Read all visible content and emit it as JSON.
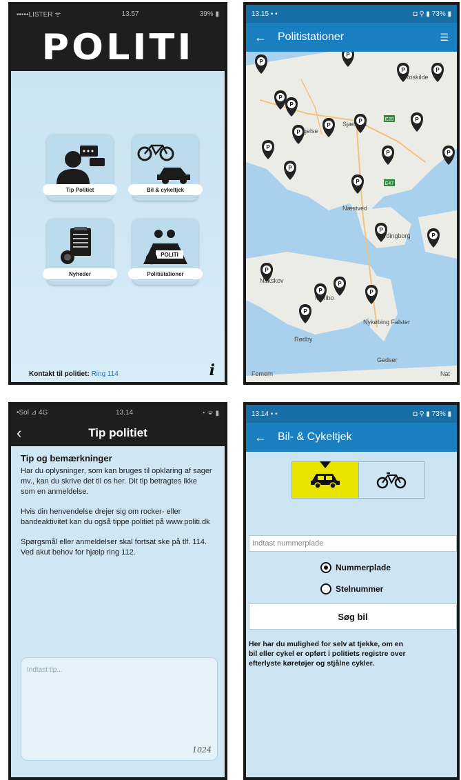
{
  "home": {
    "status": {
      "carrier": "•••••LISTER ᯤ",
      "time": "13.57",
      "battery": "39% ▮"
    },
    "logo": "POLITI",
    "tiles": [
      {
        "label": "Tip Politiet"
      },
      {
        "label": "Bil & cykeltjek"
      },
      {
        "label": "Nyheder"
      },
      {
        "label": "Politistationer"
      }
    ],
    "badge_text": "POLITI",
    "contact_label": "Kontakt til politiet:",
    "contact_link": "Ring 114"
  },
  "stations": {
    "status": {
      "left": "13.15 ▪ ▪",
      "right": "◘ ⚲ ▮ 73% ▮"
    },
    "title": "Politistationer",
    "map_labels": [
      "Slagelse",
      "Sjælland",
      "Næstved",
      "Vordingborg",
      "Nakskov",
      "Maribo",
      "Nykøbing Falster",
      "Rødby",
      "Gedser",
      "Femern",
      "Roskilde",
      "Nat"
    ],
    "road_labels": [
      "E20",
      "E47"
    ]
  },
  "tip": {
    "status": {
      "left": "•Sol ⊿ 4G",
      "time": "13.14",
      "right": "◔ ᯤ ▮"
    },
    "title": "Tip politiet",
    "heading": "Tip og bemærkninger",
    "paragraphs": [
      "Har du oplysninger, som kan bruges til opklaring af sager mv., kan du skrive det til os her. Dit tip betragtes ikke som en anmeldelse.",
      "Hvis din henvendelse drejer sig om rocker- eller bandeaktivitet kan du også tippe politiet på www.politi.dk",
      "Spørgsmål eller anmeldelser skal fortsat ske på tlf. 114. Ved akut behov for hjælp ring 112."
    ],
    "textarea_placeholder": "Indtast tip...",
    "char_count": "1024"
  },
  "check": {
    "status": {
      "left": "13.14 ▪ ▪",
      "right": "◘ ⚲ ▮ 73% ▮"
    },
    "title": "Bil- & Cykeltjek",
    "plate_placeholder": "Indtast nummerplade",
    "radio_options": [
      "Nummerplade",
      "Stelnummer"
    ],
    "selected_option": "Nummerplade",
    "search_label": "Søg bil",
    "description_lines": [
      "Her har du mulighed for selv at tjekke, om en",
      "bil eller cykel er opført i politiets registre over",
      "efterlyste køretøjer og stjålne cykler."
    ]
  },
  "colors": {
    "accent_blue": "#1a7fc1",
    "active_segment": "#e8e400",
    "marker": "#222222",
    "app_background": "#cfe6f3"
  },
  "icons": [
    "user-chat-icon",
    "bicycle-icon",
    "car-icon",
    "news-icon",
    "police-badge-icon",
    "location-marker-icon",
    "back-arrow-icon",
    "menu-icon",
    "info-icon"
  ]
}
